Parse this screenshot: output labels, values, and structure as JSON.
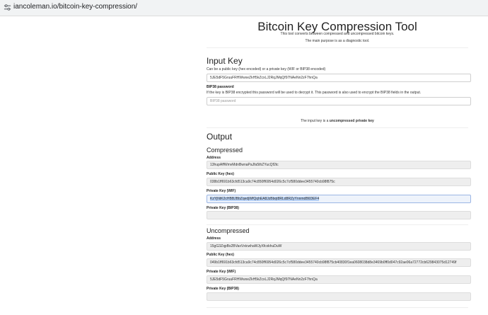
{
  "browser": {
    "url": "iancoleman.io/bitcoin-key-compression/",
    "tune_icon": "tune-icon"
  },
  "header": {
    "title": "Bitcoin Key Compression Tool",
    "subtitle1": "This tool converts between compressed and uncompressed bitcoin keys.",
    "subtitle2": "The main purpose is as a diagnostic tool."
  },
  "input": {
    "heading": "Input Key",
    "help": "Can be a public key (hex encoded) or a private key (WIF or BIP38 encoded)",
    "key_value": "5JE5dF5GruuFRHWwxeZkH5kZcxLJ2RqJMqQf97NAeNn2zF7hnQa",
    "bip38_label": "BIP38 password",
    "bip38_help": "If the key is BIP38 encrypted this password will be used to decrypt it. This password is also used to encrypt the BIP38 fields in the output.",
    "bip38_placeholder": "BIP38 password",
    "status_prefix": "The input key is a ",
    "status_value": "uncompressed private key"
  },
  "output": {
    "heading": "Output",
    "compressed": {
      "heading": "Compressed",
      "address_label": "Address",
      "address": "13hupAffWmvMdnBwnaPaJfa5thZYucQf2tc",
      "pubkey_label": "Public Key (hex)",
      "pubkey": "038b1ff691b63cfd513ca9c74c850ff6954d026c5c7cf580ddee3455740cb98f875c",
      "wif_label": "Private Key (WIF)",
      "wif": "KzYjNtK2cHBBJBbZqedjWfQqhEA8JzBbqt8RLd8RZyYnnmdB6DEF4",
      "bip38_label": "Private Key (BIP38)",
      "bip38": ""
    },
    "uncompressed": {
      "heading": "Uncompressed",
      "address_label": "Address",
      "address": "15gG3ZqpBs2BVaxVxtcwhaWJyXfcxkhuDuW",
      "pubkey_label": "Public Key (hex)",
      "pubkey": "049b1ff691b63cfd513ca9c74c850ff6954d026c5c7cf580ddee3455740cb98f875cb40830f1ea0608038d8e3469b0ff0d047c92ae06a72772cb629843075d12749f",
      "wif_label": "Private Key (WIF)",
      "wif": "5JE5dF5GruuFRHWwxeZkH5kZcxLJ2RqJMqQf97NAeNn2zF7hnQa",
      "bip38_label": "Private Key (BIP38)",
      "bip38": ""
    }
  }
}
